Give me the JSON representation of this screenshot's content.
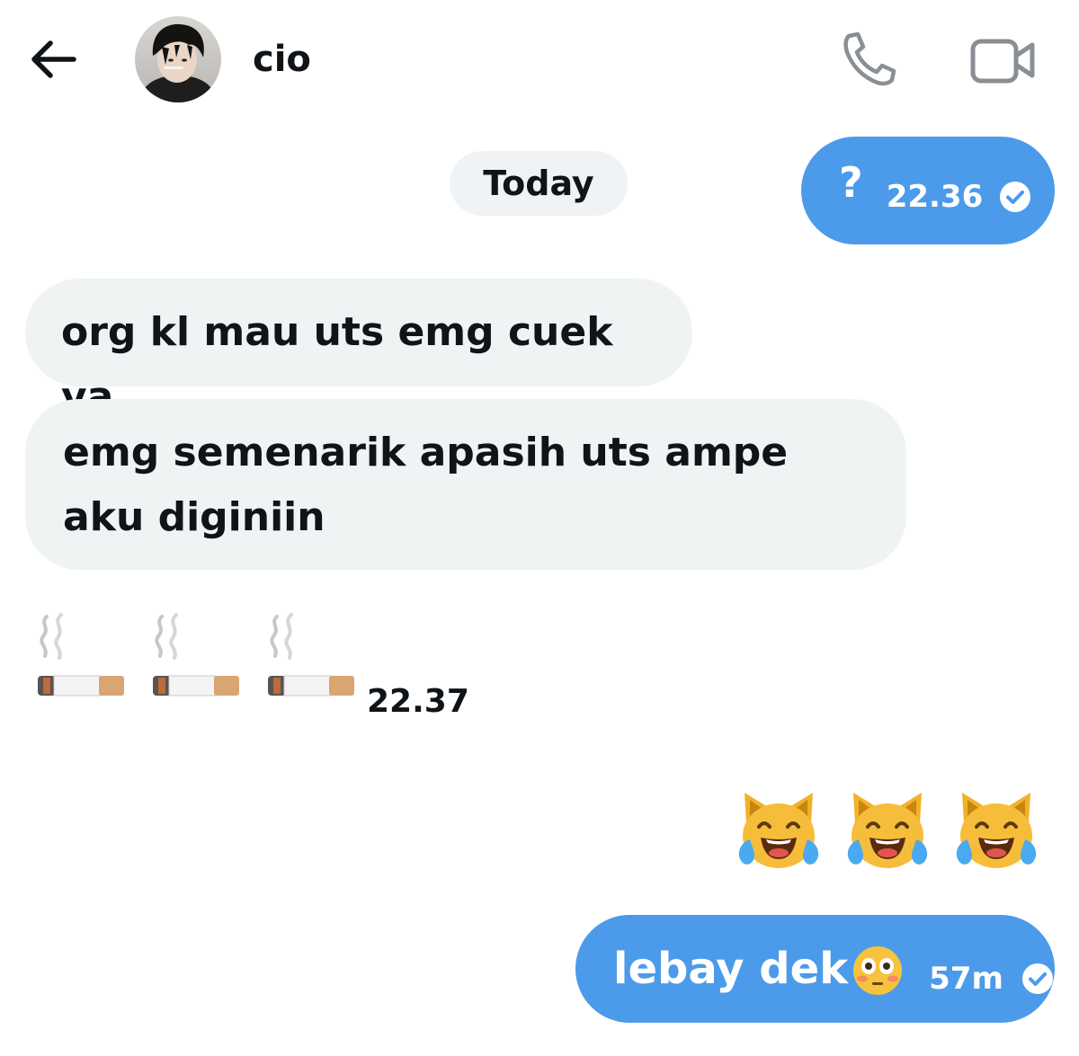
{
  "header": {
    "contact_name": "cio",
    "back_icon": "arrow-left-icon",
    "phone_icon": "phone-icon",
    "video_icon": "video-camera-icon"
  },
  "date_divider": "Today",
  "messages": [
    {
      "direction": "outgoing",
      "text": "?",
      "time": "22.36",
      "status": "read"
    },
    {
      "direction": "incoming",
      "text": "org kl mau uts emg cuek ya"
    },
    {
      "direction": "incoming",
      "text": "emg semenarik apasih uts ampe aku diginiin"
    },
    {
      "direction": "incoming",
      "emoji": [
        "cigarette-emoji",
        "cigarette-emoji",
        "cigarette-emoji"
      ],
      "time": "22.37"
    },
    {
      "direction": "outgoing",
      "emoji": [
        "cat-tears-of-joy-emoji",
        "cat-tears-of-joy-emoji",
        "cat-tears-of-joy-emoji"
      ]
    },
    {
      "direction": "outgoing",
      "text": "lebay dek",
      "emoji": "flushed-face-emoji",
      "time": "57m",
      "status": "read"
    }
  ],
  "colors": {
    "outgoing_bubble": "#4c9bea",
    "incoming_bubble": "#eff3f4",
    "date_pill": "#f0f3f5",
    "text_dark": "#0f1419",
    "icon_gray": "#8a8f94"
  }
}
